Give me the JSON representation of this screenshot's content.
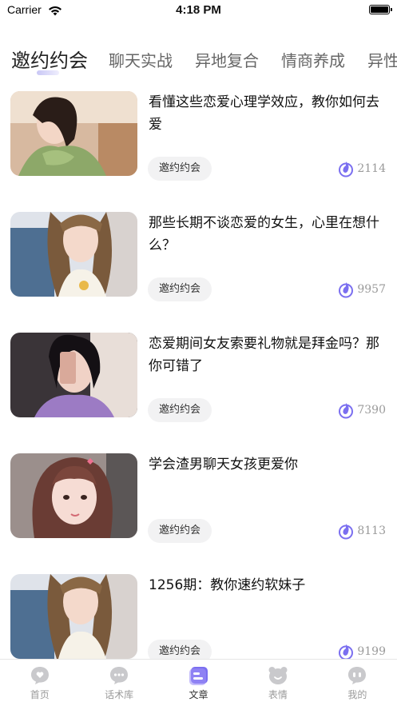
{
  "status": {
    "carrier": "Carrier",
    "time": "4:18 PM"
  },
  "tabs": [
    "邀约约会",
    "聊天实战",
    "异地复合",
    "情商养成",
    "异性"
  ],
  "articles": [
    {
      "title": "看懂这些恋爱心理学效应，教你如何去爱",
      "tag": "邀约约会",
      "views": "2114"
    },
    {
      "title": "那些长期不谈恋爱的女生，心里在想什么？",
      "tag": "邀约约会",
      "views": "9957"
    },
    {
      "title": "恋爱期间女友索要礼物就是拜金吗？那你可错了",
      "tag": "邀约约会",
      "views": "7390"
    },
    {
      "title": "学会渣男聊天女孩更爱你",
      "tag": "邀约约会",
      "views": "8113"
    },
    {
      "title": "1256期：教你速约软妹子",
      "tag": "邀约约会",
      "views": "9199"
    }
  ],
  "tabbar": [
    {
      "label": "首页",
      "icon": "heart-chat-icon"
    },
    {
      "label": "话术库",
      "icon": "chat-bubble-icon"
    },
    {
      "label": "文章",
      "icon": "article-icon",
      "active": true
    },
    {
      "label": "表情",
      "icon": "bear-face-icon"
    },
    {
      "label": "我的",
      "icon": "profile-chat-icon"
    }
  ],
  "colors": {
    "accent": "#7b6ff0",
    "tag_bg": "#f2f2f3",
    "inactive": "#c9c9cc"
  }
}
